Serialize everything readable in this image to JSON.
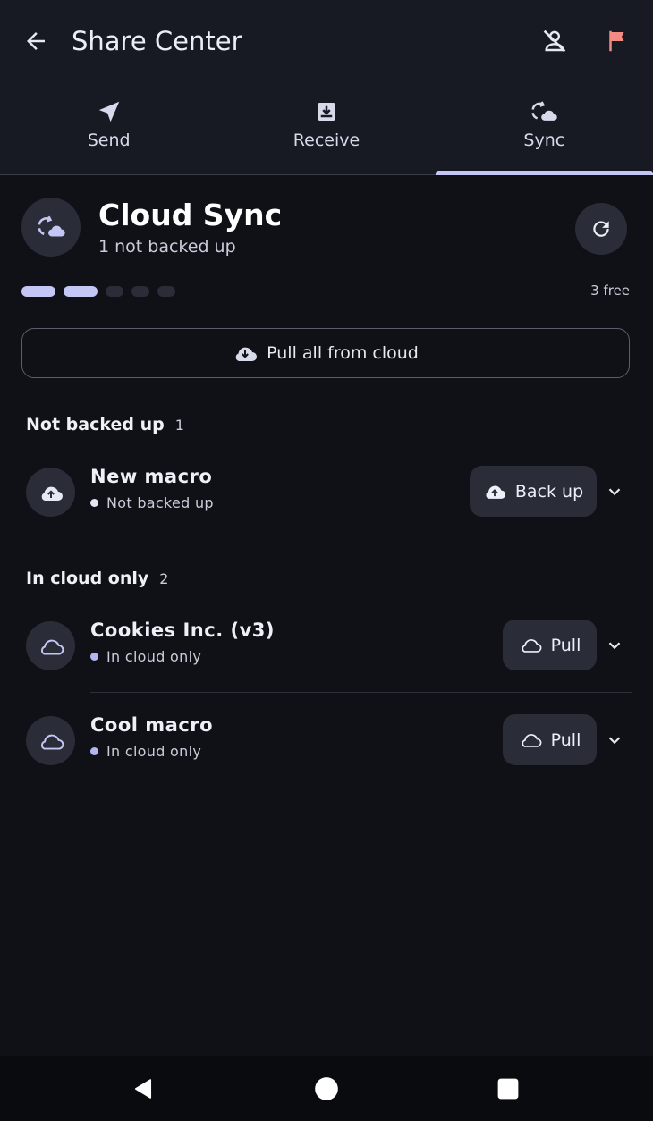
{
  "appbar": {
    "title": "Share Center"
  },
  "tabs": [
    {
      "label": "Send",
      "icon": "send-icon"
    },
    {
      "label": "Receive",
      "icon": "inbox-download-icon"
    },
    {
      "label": "Sync",
      "icon": "cloud-sync-icon",
      "active": true
    }
  ],
  "sync": {
    "title": "Cloud Sync",
    "subtitle": "1 not backed up",
    "quota": {
      "used_slots": 2,
      "total_slots": 5,
      "label": "3 free"
    },
    "pull_all_label": "Pull all from cloud"
  },
  "sections": {
    "not_backed_up": {
      "title": "Not backed up",
      "count": "1"
    },
    "cloud_only": {
      "title": "In cloud only",
      "count": "2"
    }
  },
  "items": [
    {
      "name": "New macro",
      "status": "Not backed up",
      "action": "Back up",
      "status_color": "#e4e6f2"
    },
    {
      "name": "Cookies Inc. (v3)",
      "status": "In cloud only",
      "action": "Pull",
      "status_color": "#b3b6f0"
    },
    {
      "name": "Cool macro",
      "status": "In cloud only",
      "action": "Pull",
      "status_color": "#b3b6f0"
    }
  ],
  "colors": {
    "accent": "#c4c7f5",
    "flag": "#f28b82",
    "background": "#0f1117",
    "surface": "#2a2c38"
  }
}
